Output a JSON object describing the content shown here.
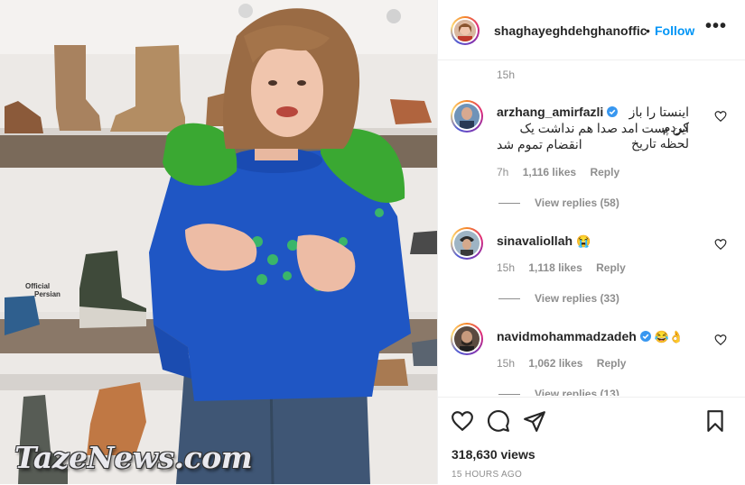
{
  "media": {
    "watermark": "TazeNews.com",
    "official_mark": [
      "Official",
      "Persian"
    ]
  },
  "header": {
    "username": "shaghayeghdehghanoffic",
    "dot": "•",
    "follow_label": "Follow",
    "more_label": "•••"
  },
  "caption_time": "15h",
  "comments": [
    {
      "username": "arzhang_amirfazli",
      "verified": true,
      "text_line1": "اینستا را باز کردم",
      "text_line2": "این پست امد صدا هم نداشت یک لحظه تاریخ",
      "text_line3": "انقضام تموم شد",
      "age": "7h",
      "likes": "1,116 likes",
      "reply": "Reply",
      "view_replies": "View replies (58)"
    },
    {
      "username": "sinavaliollah",
      "verified": false,
      "emoji": "😭",
      "age": "15h",
      "likes": "1,118 likes",
      "reply": "Reply",
      "view_replies": "View replies (33)"
    },
    {
      "username": "navidmohammadzadeh",
      "verified": true,
      "emoji": "😂👌",
      "age": "15h",
      "likes": "1,062 likes",
      "reply": "Reply",
      "view_replies": "View replies (13)"
    }
  ],
  "footer": {
    "views": "318,630 views",
    "posted": "15 HOURS AGO"
  },
  "icons": [
    "heart-icon",
    "comment-icon",
    "share-icon",
    "bookmark-icon",
    "more-icon",
    "verified-icon"
  ],
  "colors": {
    "accent": "#0095f6",
    "muted": "#8e8e8e",
    "verified": "#3897f0",
    "sweater": "#1f56c4",
    "feathers": "#3aa832"
  }
}
